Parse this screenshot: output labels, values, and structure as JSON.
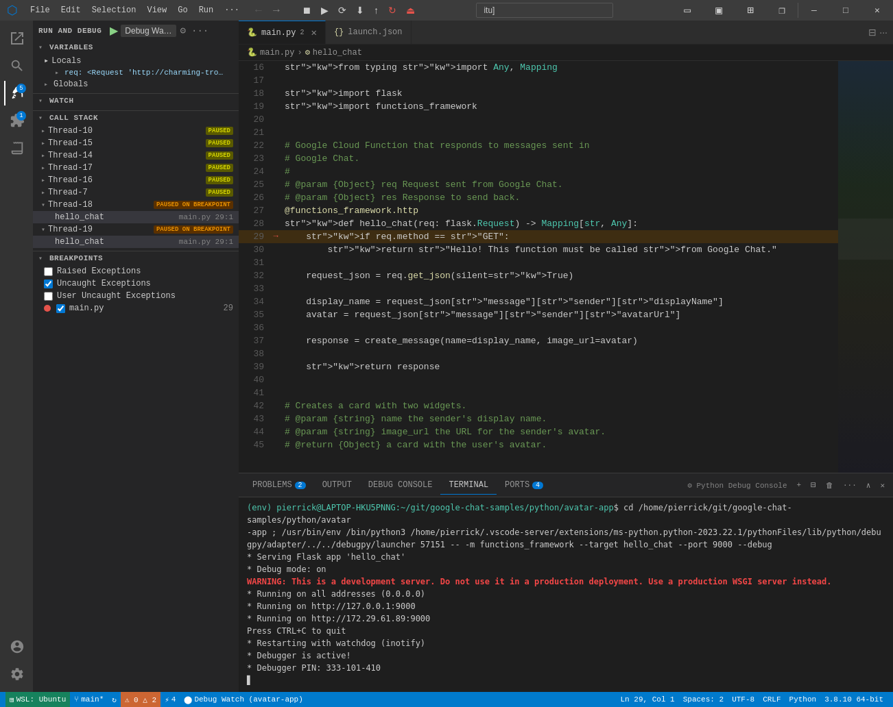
{
  "titlebar": {
    "icon": "⬡",
    "menu": [
      "File",
      "Edit",
      "Selection",
      "View",
      "Go",
      "Run"
    ],
    "more": "···",
    "back_btn": "←",
    "forward_btn": "→",
    "search_value": "itu]",
    "debug_controls": [
      "⏹",
      "▶",
      "⟳",
      "⬇",
      "⬆",
      "↻",
      "⏏"
    ],
    "window_min": "—",
    "window_max": "□",
    "window_close": "✕"
  },
  "sidebar": {
    "run_debug_title": "RUN AND DEBUG",
    "debug_play": "▶",
    "debug_config": "Debug Wa…",
    "variables_title": "VARIABLES",
    "locals_label": "Locals",
    "locals_req": "req: <Request 'http://charming-tro…",
    "globals_label": "Globals",
    "watch_title": "WATCH",
    "callstack_title": "CALL STACK",
    "threads": [
      {
        "name": "Thread-10",
        "badge": "PAUSED",
        "badge_type": "paused"
      },
      {
        "name": "Thread-15",
        "badge": "PAUSED",
        "badge_type": "paused"
      },
      {
        "name": "Thread-14",
        "badge": "PAUSED",
        "badge_type": "paused"
      },
      {
        "name": "Thread-17",
        "badge": "PAUSED",
        "badge_type": "paused"
      },
      {
        "name": "Thread-16",
        "badge": "PAUSED",
        "badge_type": "paused"
      },
      {
        "name": "Thread-7",
        "badge": "PAUSED",
        "badge_type": "paused"
      },
      {
        "name": "Thread-18",
        "badge": "PAUSED ON BREAKPOINT",
        "badge_type": "paused_bp",
        "frames": [
          {
            "name": "hello_chat",
            "file": "main.py",
            "line": "29:1"
          }
        ]
      },
      {
        "name": "Thread-19",
        "badge": "PAUSED ON BREAKPOINT",
        "badge_type": "paused_bp",
        "frames": [
          {
            "name": "hello_chat",
            "file": "main.py",
            "line": "29:1"
          }
        ]
      }
    ],
    "breakpoints_title": "BREAKPOINTS",
    "breakpoints": [
      {
        "label": "Raised Exceptions",
        "checked": false,
        "type": "checkbox"
      },
      {
        "label": "Uncaught Exceptions",
        "checked": true,
        "type": "checkbox"
      },
      {
        "label": "User Uncaught Exceptions",
        "checked": false,
        "type": "checkbox"
      },
      {
        "label": "main.py",
        "checked": true,
        "type": "dot",
        "line": "29"
      }
    ]
  },
  "tabs": [
    {
      "label": "main.py",
      "badge": "2",
      "icon": "🐍",
      "active": true,
      "modified": false
    },
    {
      "label": "launch.json",
      "icon": "{}",
      "active": false
    }
  ],
  "breadcrumb": {
    "file": "main.py",
    "symbol": "hello_chat"
  },
  "editor": {
    "lines": [
      {
        "num": 16,
        "text": "from typing import Any, Mapping",
        "bp": false,
        "current": false
      },
      {
        "num": 17,
        "text": "",
        "bp": false,
        "current": false
      },
      {
        "num": 18,
        "text": "import flask",
        "bp": false,
        "current": false
      },
      {
        "num": 19,
        "text": "import functions_framework",
        "bp": false,
        "current": false
      },
      {
        "num": 20,
        "text": "",
        "bp": false,
        "current": false
      },
      {
        "num": 21,
        "text": "",
        "bp": false,
        "current": false
      },
      {
        "num": 22,
        "text": "# Google Cloud Function that responds to messages sent in",
        "bp": false,
        "current": false
      },
      {
        "num": 23,
        "text": "# Google Chat.",
        "bp": false,
        "current": false
      },
      {
        "num": 24,
        "text": "#",
        "bp": false,
        "current": false
      },
      {
        "num": 25,
        "text": "# @param {Object} req Request sent from Google Chat.",
        "bp": false,
        "current": false
      },
      {
        "num": 26,
        "text": "# @param {Object} res Response to send back.",
        "bp": false,
        "current": false
      },
      {
        "num": 27,
        "text": "@functions_framework.http",
        "bp": false,
        "current": false
      },
      {
        "num": 28,
        "text": "def hello_chat(req: flask.Request) -> Mapping[str, Any]:",
        "bp": false,
        "current": false
      },
      {
        "num": 29,
        "text": "    if req.method == \"GET\":",
        "bp": true,
        "current": true
      },
      {
        "num": 30,
        "text": "        return \"Hello! This function must be called from Google Chat.\"",
        "bp": false,
        "current": false
      },
      {
        "num": 31,
        "text": "",
        "bp": false,
        "current": false
      },
      {
        "num": 32,
        "text": "    request_json = req.get_json(silent=True)",
        "bp": false,
        "current": false
      },
      {
        "num": 33,
        "text": "",
        "bp": false,
        "current": false
      },
      {
        "num": 34,
        "text": "    display_name = request_json[\"message\"][\"sender\"][\"displayName\"]",
        "bp": false,
        "current": false
      },
      {
        "num": 35,
        "text": "    avatar = request_json[\"message\"][\"sender\"][\"avatarUrl\"]",
        "bp": false,
        "current": false
      },
      {
        "num": 36,
        "text": "",
        "bp": false,
        "current": false
      },
      {
        "num": 37,
        "text": "    response = create_message(name=display_name, image_url=avatar)",
        "bp": false,
        "current": false
      },
      {
        "num": 38,
        "text": "",
        "bp": false,
        "current": false
      },
      {
        "num": 39,
        "text": "    return response",
        "bp": false,
        "current": false
      },
      {
        "num": 40,
        "text": "",
        "bp": false,
        "current": false
      },
      {
        "num": 41,
        "text": "",
        "bp": false,
        "current": false
      },
      {
        "num": 42,
        "text": "# Creates a card with two widgets.",
        "bp": false,
        "current": false
      },
      {
        "num": 43,
        "text": "# @param {string} name the sender's display name.",
        "bp": false,
        "current": false
      },
      {
        "num": 44,
        "text": "# @param {string} image_url the URL for the sender's avatar.",
        "bp": false,
        "current": false
      },
      {
        "num": 45,
        "text": "# @return {Object} a card with the user's avatar.",
        "bp": false,
        "current": false
      }
    ]
  },
  "panel": {
    "tabs": [
      {
        "label": "PROBLEMS",
        "badge": "2"
      },
      {
        "label": "OUTPUT"
      },
      {
        "label": "DEBUG CONSOLE"
      },
      {
        "label": "TERMINAL",
        "active": true
      },
      {
        "label": "PORTS",
        "badge": "4"
      }
    ],
    "terminal_name": "Python Debug Console",
    "terminal_lines": [
      "(env) pierrick@LAPTOP-HKU5PNNG:~/git/google-chat-samples/python/avatar-app$ cd /home/pierrick/git/google-chat-samples/python/avatar-app ; /usr/bin/env /bin/python3 /home/pierrick/.vscode-server/extensions/ms-python.python-2023.22.1/pythonFiles/lib/python/debugpy/adapter/../../debugpy/launcher 57151 -- -m functions_framework --target hello_chat --port 9000 --debug",
      " * Serving Flask app 'hello_chat'",
      " * Debug mode: on",
      "WARNING: This is a development server. Do not use it in a production deployment. Use a production WSGI server instead.",
      " * Running on all addresses (0.0.0.0)",
      " * Running on http://127.0.0.1:9000",
      " * Running on http://172.29.61.89:9000",
      "Press CTRL+C to quit",
      " * Restarting with watchdog (inotify)",
      " * Debugger is active!",
      " * Debugger PIN: 333-101-410"
    ]
  },
  "statusbar": {
    "wsl": "WSL: Ubuntu",
    "branch": "main*",
    "sync_icon": "↻",
    "errors": "⚠ 0 △ 2",
    "debug_watch": "⚡ 4",
    "debug_app": "Debug Watch (avatar-app)",
    "cursor": "Ln 29, Col 1",
    "spaces": "Spaces: 2",
    "encoding": "UTF-8",
    "eol": "CRLF",
    "language": "Python",
    "version": "3.8.10 64-bit"
  }
}
